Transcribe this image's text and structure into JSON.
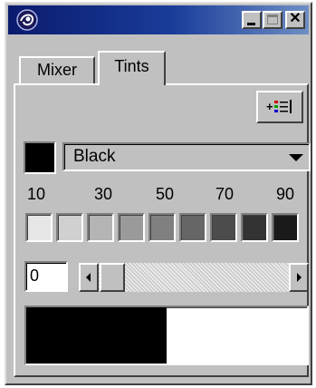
{
  "window": {
    "title": "",
    "controls": {
      "minimize_icon": "minimize-icon",
      "maximize_icon": "maximize-icon",
      "close_glyph": "✕"
    }
  },
  "tabs": [
    {
      "label": "Mixer",
      "active": false
    },
    {
      "label": "Tints",
      "active": true
    }
  ],
  "color": {
    "selected": "Black",
    "swatch_hex": "#000000"
  },
  "tints": {
    "labels": [
      "10",
      "30",
      "50",
      "70",
      "90"
    ],
    "cells": [
      "#e6e6e6",
      "#d0d0d0",
      "#b4b4b4",
      "#9a9a9a",
      "#808080",
      "#666666",
      "#4c4c4c",
      "#333333",
      "#1a1a1a"
    ]
  },
  "tint_value": {
    "field_value": "0",
    "slider_fraction": 0.0
  },
  "preview": {
    "left_hex": "#000000",
    "right_hex": "#ffffff",
    "black_fraction": 0.5
  },
  "icons": {
    "app": "app-logo-icon",
    "options": "add-swatch-list-icon"
  }
}
